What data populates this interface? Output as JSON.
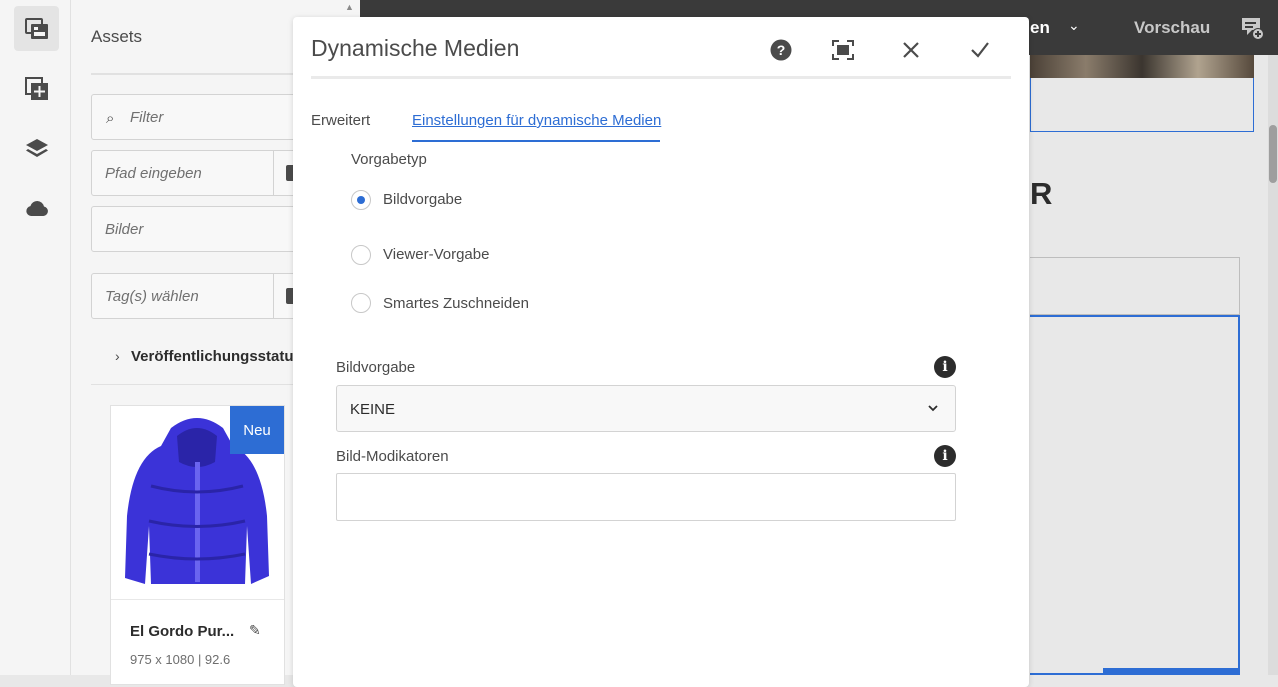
{
  "left_rail": {
    "items": [
      {
        "icon": "assets-icon",
        "active": true
      },
      {
        "icon": "add-component-icon",
        "active": false
      },
      {
        "icon": "layers-icon",
        "active": false
      },
      {
        "icon": "cloud-icon",
        "active": false
      }
    ]
  },
  "asset_panel": {
    "title": "Assets",
    "filter_placeholder": "Filter",
    "path_placeholder": "Pfad eingeben",
    "type_value": "Bilder",
    "tags_placeholder": "Tag(s) wählen",
    "publish_status_label": "Veröffentlichungsstatus",
    "card": {
      "badge": "Neu",
      "title": "El Gordo Pur...",
      "meta": "975 x 1080 | 92.6"
    }
  },
  "editor_topbar": {
    "language_partial": "en",
    "preview_label": "Vorschau"
  },
  "canvas": {
    "heading_partial": "R"
  },
  "dialog": {
    "title": "Dynamische Medien",
    "icons": [
      "help-icon",
      "fullscreen-icon",
      "close-icon",
      "confirm-icon"
    ],
    "tabs": [
      {
        "label": "Erweitert",
        "active": false
      },
      {
        "label": "Einstellungen für dynamische Medien",
        "active": true
      }
    ],
    "preset_type_label": "Vorgabetyp",
    "preset_types": [
      {
        "label": "Bildvorgabe",
        "selected": true
      },
      {
        "label": "Viewer-Vorgabe",
        "selected": false
      },
      {
        "label": "Smartes Zuschneiden",
        "selected": false
      }
    ],
    "image_preset_label": "Bildvorgabe",
    "image_preset_value": "KEINE",
    "image_modifiers_label": "Bild-Modikatoren",
    "image_modifiers_value": ""
  },
  "colors": {
    "accent": "#2d6dd4",
    "topbar": "#3a3a3a",
    "panel": "#f5f5f5"
  }
}
